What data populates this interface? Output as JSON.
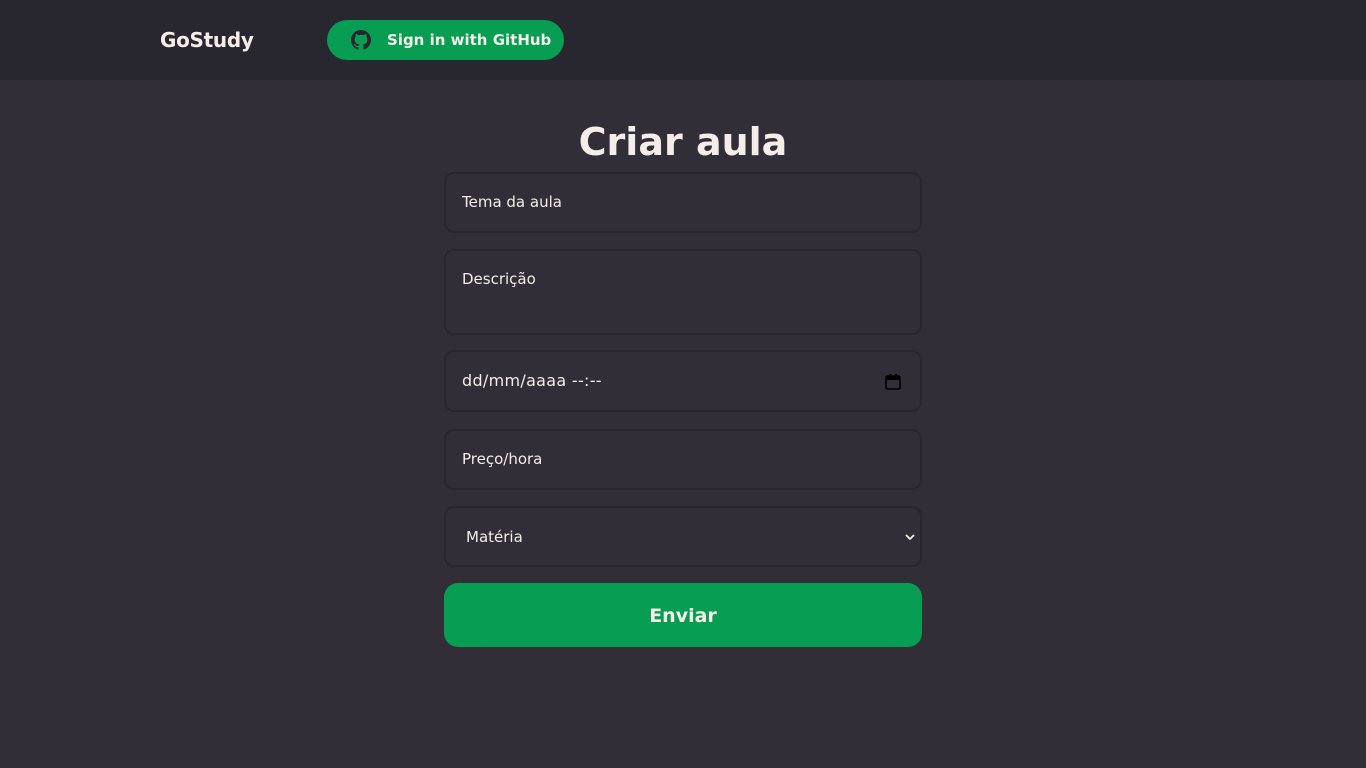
{
  "header": {
    "logo": "GoStudy",
    "github_button_label": "Sign in with GitHub",
    "github_icon": "github-icon"
  },
  "form": {
    "title": "Criar aula",
    "tema_placeholder": "Tema da aula",
    "descricao_placeholder": "Descrição",
    "datetime_placeholder": "dd/mm/aaaa --:--",
    "calendar_icon": "calendar-icon",
    "preco_placeholder": "Preço/hora",
    "materia_selected": "Matéria",
    "select_icon": "chevron-down-icon",
    "submit_label": "Enviar"
  },
  "colors": {
    "background": "#312e38",
    "header_background": "#28262e",
    "accent": "#079d52",
    "text": "#f4ede8",
    "border": "#28262e"
  }
}
